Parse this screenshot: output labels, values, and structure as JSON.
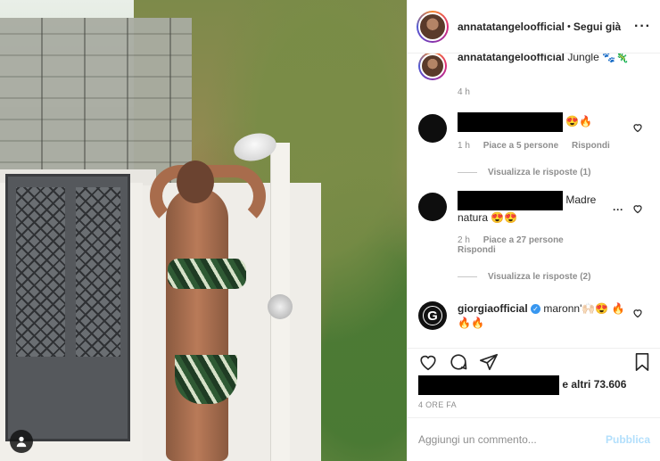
{
  "post": {
    "username": "annatatangeloofficial",
    "follow_status": "Segui già",
    "more_icon": "more-horizontal-icon"
  },
  "caption": {
    "username": "annatatangeloofficial",
    "text": "Jungle 🐾🦎",
    "time": "4 h"
  },
  "comments": [
    {
      "text": "😍🔥",
      "time": "1 h",
      "likes": "Piace a 5 persone",
      "reply": "Rispondi",
      "view_replies": "Visualizza le risposte (1)"
    },
    {
      "text": "Madre natura 😍😍",
      "time": "2 h",
      "likes": "Piace a 27 persone",
      "reply": "Rispondi",
      "view_replies": "Visualizza le risposte (2)"
    },
    {
      "username": "giorgiaofficial",
      "text": "maronn'🙌🏻😍 🔥🔥🔥"
    }
  ],
  "likes_summary": "e altri 73.606",
  "posted_ago": "4 ORE FA",
  "comment_box": {
    "placeholder": "Aggiungi un commento...",
    "publish_label": "Pubblica"
  },
  "colors": {
    "link_blue": "#3897f0",
    "publish_disabled": "#b2dffc",
    "secondary_text": "#8e8e8e"
  }
}
